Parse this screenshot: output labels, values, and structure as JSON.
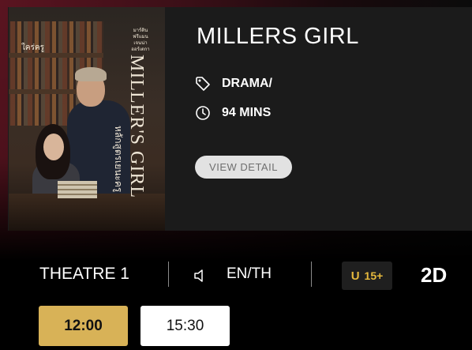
{
  "movie": {
    "title": "MILLERS GIRL",
    "genre": "DRAMA/",
    "duration": "94 MINS",
    "view_detail_label": "VIEW DETAIL",
    "poster": {
      "title_text": "MILLER'S GIRL",
      "thai_tagline": "ใคร่ครู",
      "thai_title": "หลักสูตรเยนะครู",
      "cast_names": "มาร์ติน ฟรีแมน เจนน่า ออร์เตกา"
    }
  },
  "showtime_info": {
    "theatre": "THEATRE 1",
    "language": "EN/TH",
    "rating": {
      "u": "U",
      "age": "15+"
    },
    "format": "2D"
  },
  "times": [
    {
      "label": "12:00",
      "state": "selected"
    },
    {
      "label": "15:30",
      "state": "available"
    }
  ],
  "icons": {
    "genre": "tag-icon",
    "duration": "clock-icon",
    "language": "speaker-icon"
  },
  "colors": {
    "accent_gold": "#d8b257",
    "rating_gold": "#e6b93d",
    "card_bg": "#1b1b1b",
    "button_gray": "#e2e2e2"
  }
}
